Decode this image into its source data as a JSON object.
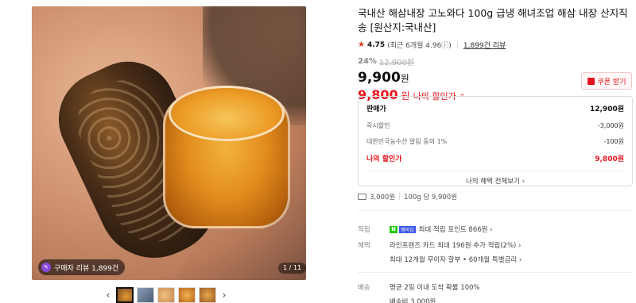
{
  "product": {
    "title": "국내산 해삼내장 고노와다 100g 급냉 해녀조업 해삼 내장 산지직송 [원산지:국내산]",
    "rating": "4.75",
    "rating_detail": "(최근 6개월 4.96ⓘ)",
    "review_count": "1,899건 리뷰",
    "discount_pct": "24%",
    "original_price": "12,900원",
    "price": "9,900",
    "price_unit": "원",
    "my_price": "9,800",
    "my_price_unit": "원",
    "my_price_label": "나의 할인가",
    "my_price_chevron": "⌃"
  },
  "coupon": {
    "label": "쿠폰 받기"
  },
  "benefits": {
    "header_label": "판매가",
    "header_value": "12,900원",
    "rows": [
      {
        "label": "즉시할인",
        "value": "-3,000원"
      },
      {
        "label": "대한민국농수산 알림 동의 1%",
        "value": "-100원"
      }
    ],
    "mine_label": "나의 할인가",
    "mine_value": "9,800원",
    "all_link": "나의 혜택 전체보기 ›"
  },
  "shipping": {
    "fee": "3,000원",
    "unit_price": "100g 당 9,900원"
  },
  "points": {
    "key": "적립",
    "badge_n": "N",
    "badge_m": "멤버십",
    "text": "최대 적립 포인트 866원 ›"
  },
  "card_benefits": {
    "key": "혜택",
    "lines": [
      "라인프렌즈 카드 최대 196원 추가 적립(2%) ›",
      "최대 12개월 무이자 할부 • 60개월 특별금리 ›"
    ]
  },
  "delivery": {
    "key": "배송",
    "lines": [
      "평균 2일 이내 도착 확률 100%",
      "배송비 3,000원"
    ]
  },
  "media": {
    "review_badge": "구매자 리뷰 1,899건",
    "page_indicator": "1 / 11",
    "prev": "‹",
    "next": "›"
  }
}
